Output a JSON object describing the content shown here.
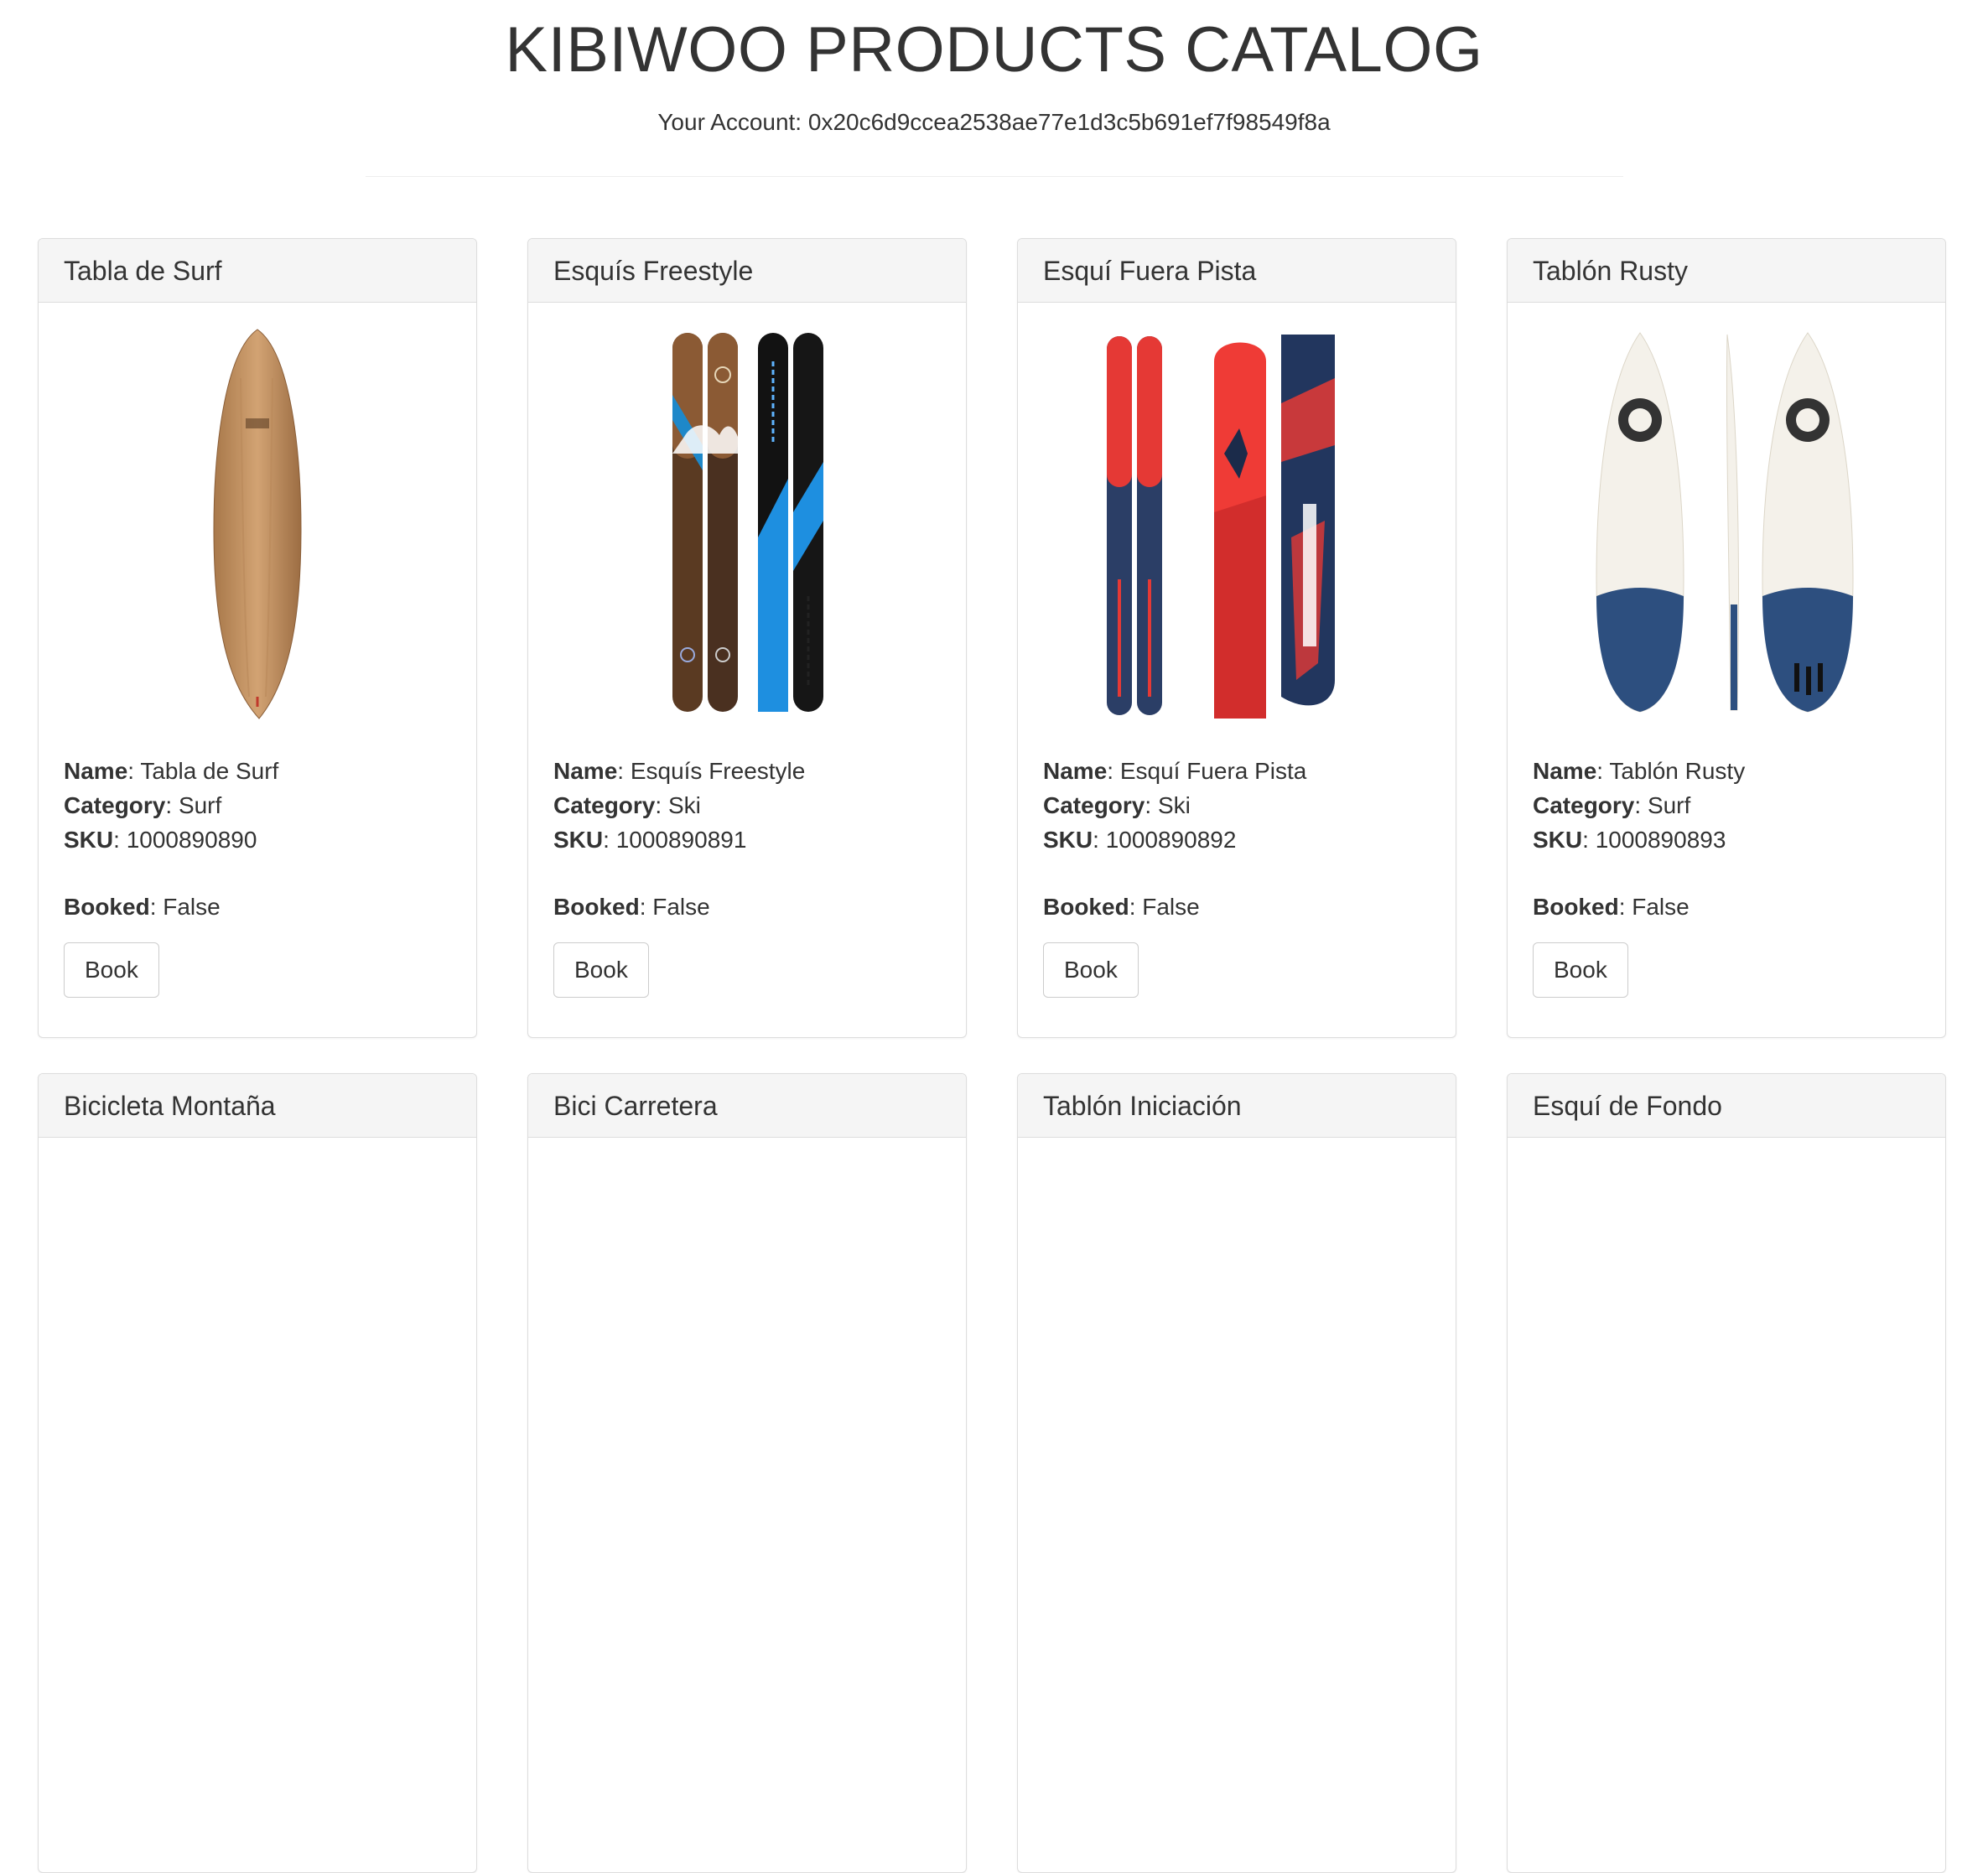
{
  "header": {
    "title": "KIBIWOO PRODUCTS CATALOG",
    "account_label": "Your Account:",
    "account_value": "0x20c6d9ccea2538ae77e1d3c5b691ef7f98549f8a"
  },
  "labels": {
    "name": "Name",
    "category": "Category",
    "sku": "SKU",
    "booked": "Booked",
    "book_button": "Book"
  },
  "products": [
    {
      "title": "Tabla de Surf",
      "name": "Tabla de Surf",
      "category": "Surf",
      "sku": "1000890890",
      "booked": "False",
      "image": "wooden-longboard-surfboard"
    },
    {
      "title": "Esquís Freestyle",
      "name": "Esquís Freestyle",
      "category": "Ski",
      "sku": "1000890891",
      "booked": "False",
      "image": "freestyle-skis"
    },
    {
      "title": "Esquí Fuera Pista",
      "name": "Esquí Fuera Pista",
      "category": "Ski",
      "sku": "1000890892",
      "booked": "False",
      "image": "offpiste-skis"
    },
    {
      "title": "Tablón Rusty",
      "name": "Tablón Rusty",
      "category": "Surf",
      "sku": "1000890893",
      "booked": "False",
      "image": "shortboard-surfboard"
    },
    {
      "title": "Bicicleta Montaña"
    },
    {
      "title": "Bici Carretera"
    },
    {
      "title": "Tablón Iniciación"
    },
    {
      "title": "Esquí de Fondo"
    }
  ]
}
